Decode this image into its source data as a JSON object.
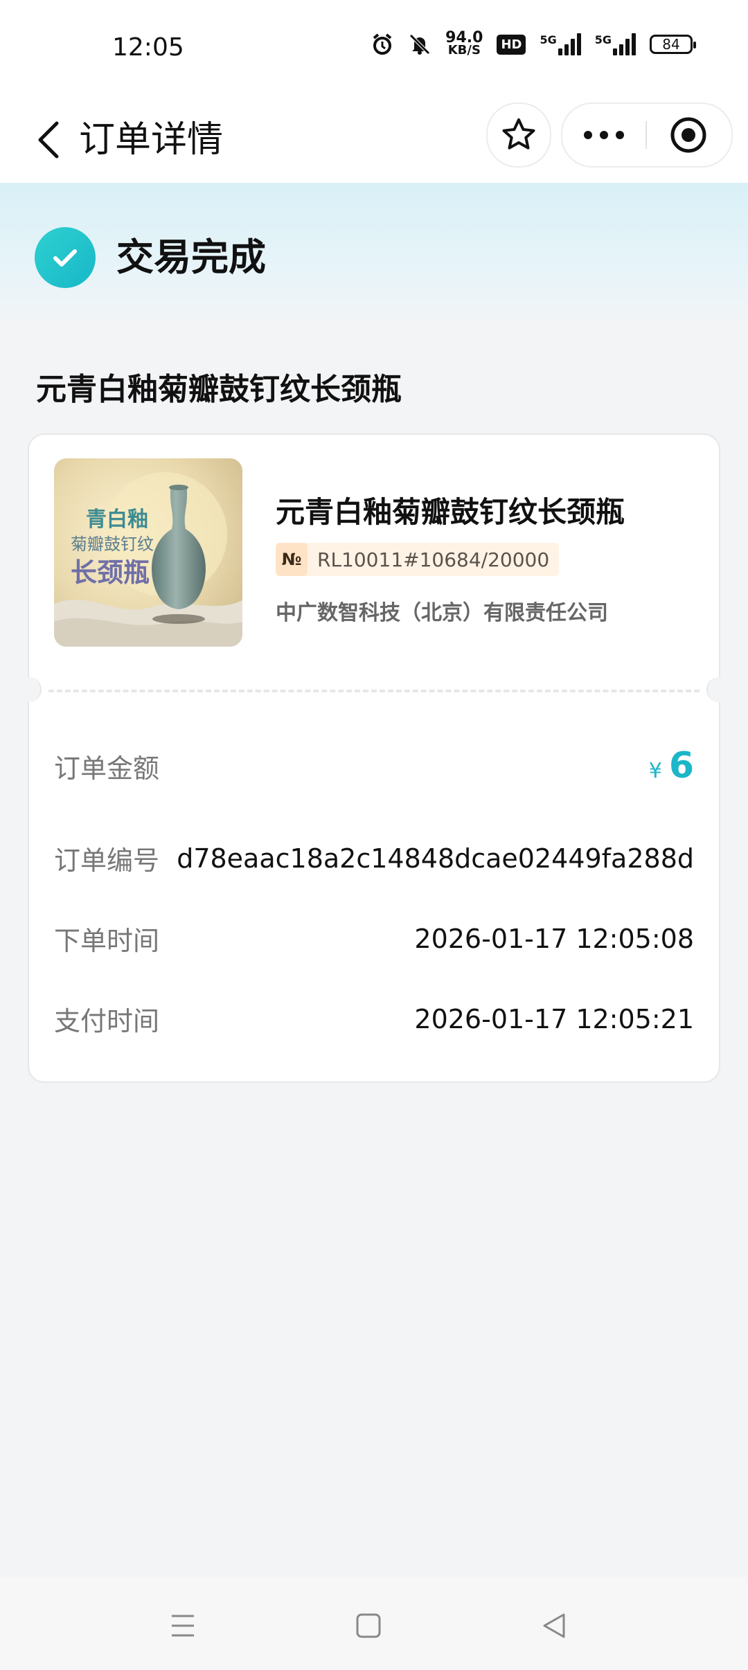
{
  "status_bar": {
    "time": "12:05",
    "net_speed_value": "94.0",
    "net_speed_unit": "KB/S",
    "hd_label": "HD",
    "signal_label_1": "5G",
    "signal_label_2": "5G",
    "battery": "84"
  },
  "header": {
    "title": "订单详情"
  },
  "order_status": {
    "text": "交易完成"
  },
  "product": {
    "heading": "元青白釉菊瓣鼓钉纹长颈瓶",
    "title": "元青白釉菊瓣鼓钉纹长颈瓶",
    "serial_prefix": "№",
    "serial": "RL10011#10684/20000",
    "company": "中广数智科技（北京）有限责任公司",
    "thumb_text_line1": "青白釉",
    "thumb_text_line2": "菊瓣鼓钉纹",
    "thumb_text_line3": "长颈瓶"
  },
  "details": {
    "amount_label": "订单金额",
    "amount_currency": "¥",
    "amount_value": "6",
    "order_no_label": "订单编号",
    "order_no_value": "d78eaac18a2c14848dcae02449fa288d",
    "order_time_label": "下单时间",
    "order_time_value": "2026-01-17 12:05:08",
    "pay_time_label": "支付时间",
    "pay_time_value": "2026-01-17 12:05:21"
  },
  "colors": {
    "accent": "#1cb6c9",
    "check": "#2fd0d0"
  }
}
